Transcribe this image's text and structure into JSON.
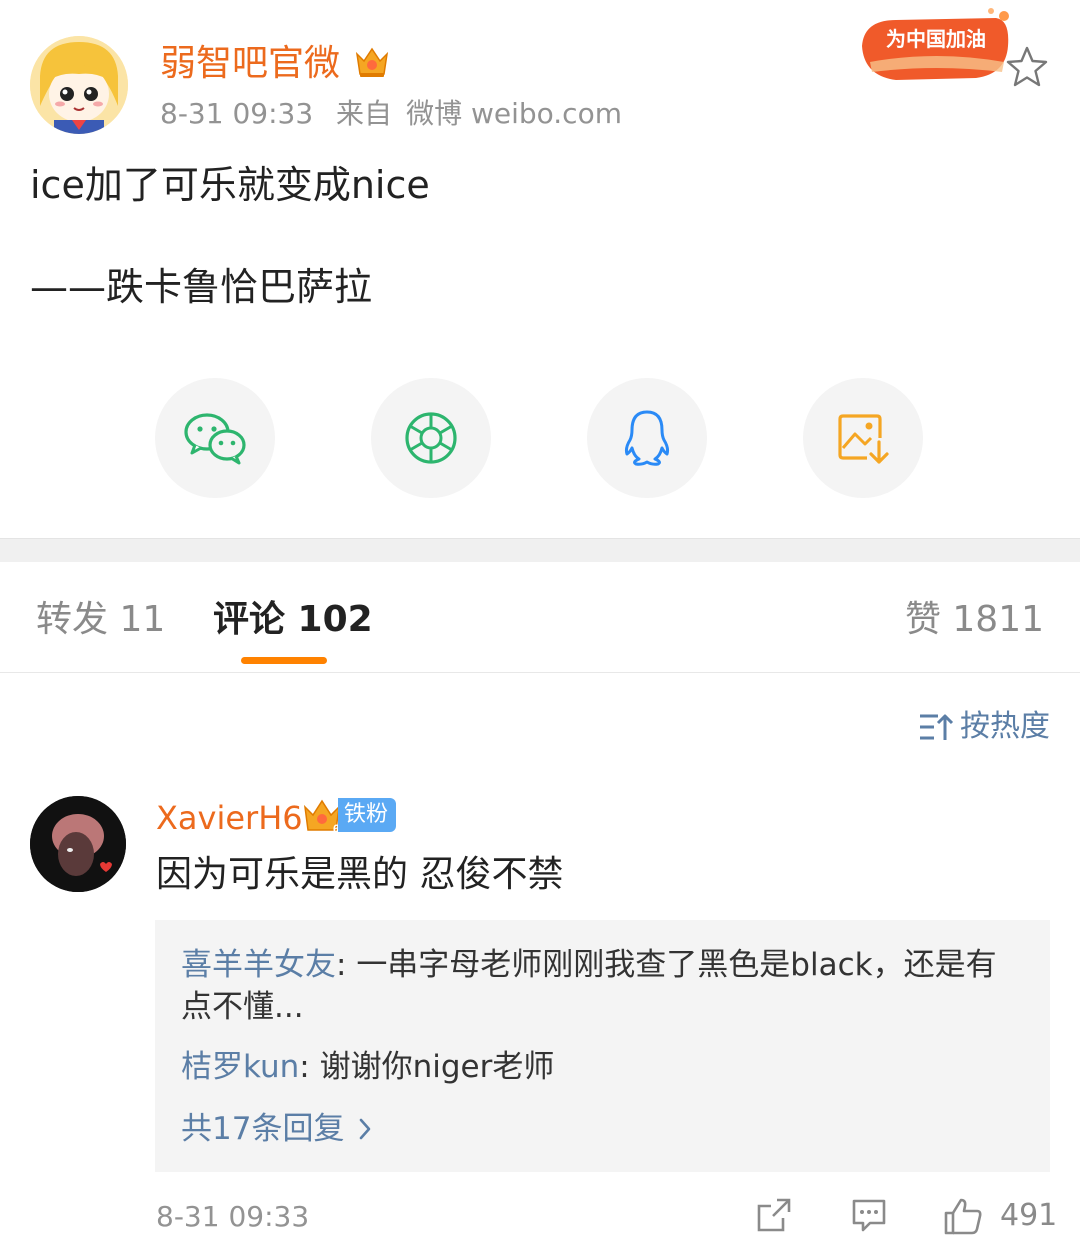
{
  "post": {
    "author": "弱智吧官微",
    "time": "8-31 09:33",
    "source_prefix": "来自",
    "source": "微博 weibo.com",
    "event_badge": "为中国加油",
    "text_line1": "ice加了可乐就变成nice",
    "text_line2": "——跌卡鲁恰巴萨拉"
  },
  "share": {
    "icons": [
      "wechat-icon",
      "moments-icon",
      "qq-icon",
      "save-image-icon"
    ]
  },
  "tabs": {
    "reposts": "转发 11",
    "comments": "评论 102",
    "likes": "赞 1811"
  },
  "sort": {
    "label": "按热度"
  },
  "comment": {
    "user": "XavierH6",
    "crown_level": "6",
    "fan_badge": "铁粉",
    "text": "因为可乐是黑的 忍俊不禁",
    "replies": [
      {
        "user": "喜羊羊女友",
        "sep": ": ",
        "text_a": "一串字母老师刚刚我查了黑色是black，还是有",
        "text_b": "点不懂..."
      },
      {
        "user": "桔罗kun",
        "sep": ": ",
        "text": "谢谢你niger老师"
      }
    ],
    "more_replies": "共17条回复",
    "time": "8-31 09:33",
    "like_count": "491"
  },
  "colors": {
    "accent_orange": "#ff8200",
    "name_orange": "#ec6a1d",
    "link_blue": "#5b7ea6",
    "fan_blue": "#5aa9f4",
    "meta_gray": "#939393"
  }
}
